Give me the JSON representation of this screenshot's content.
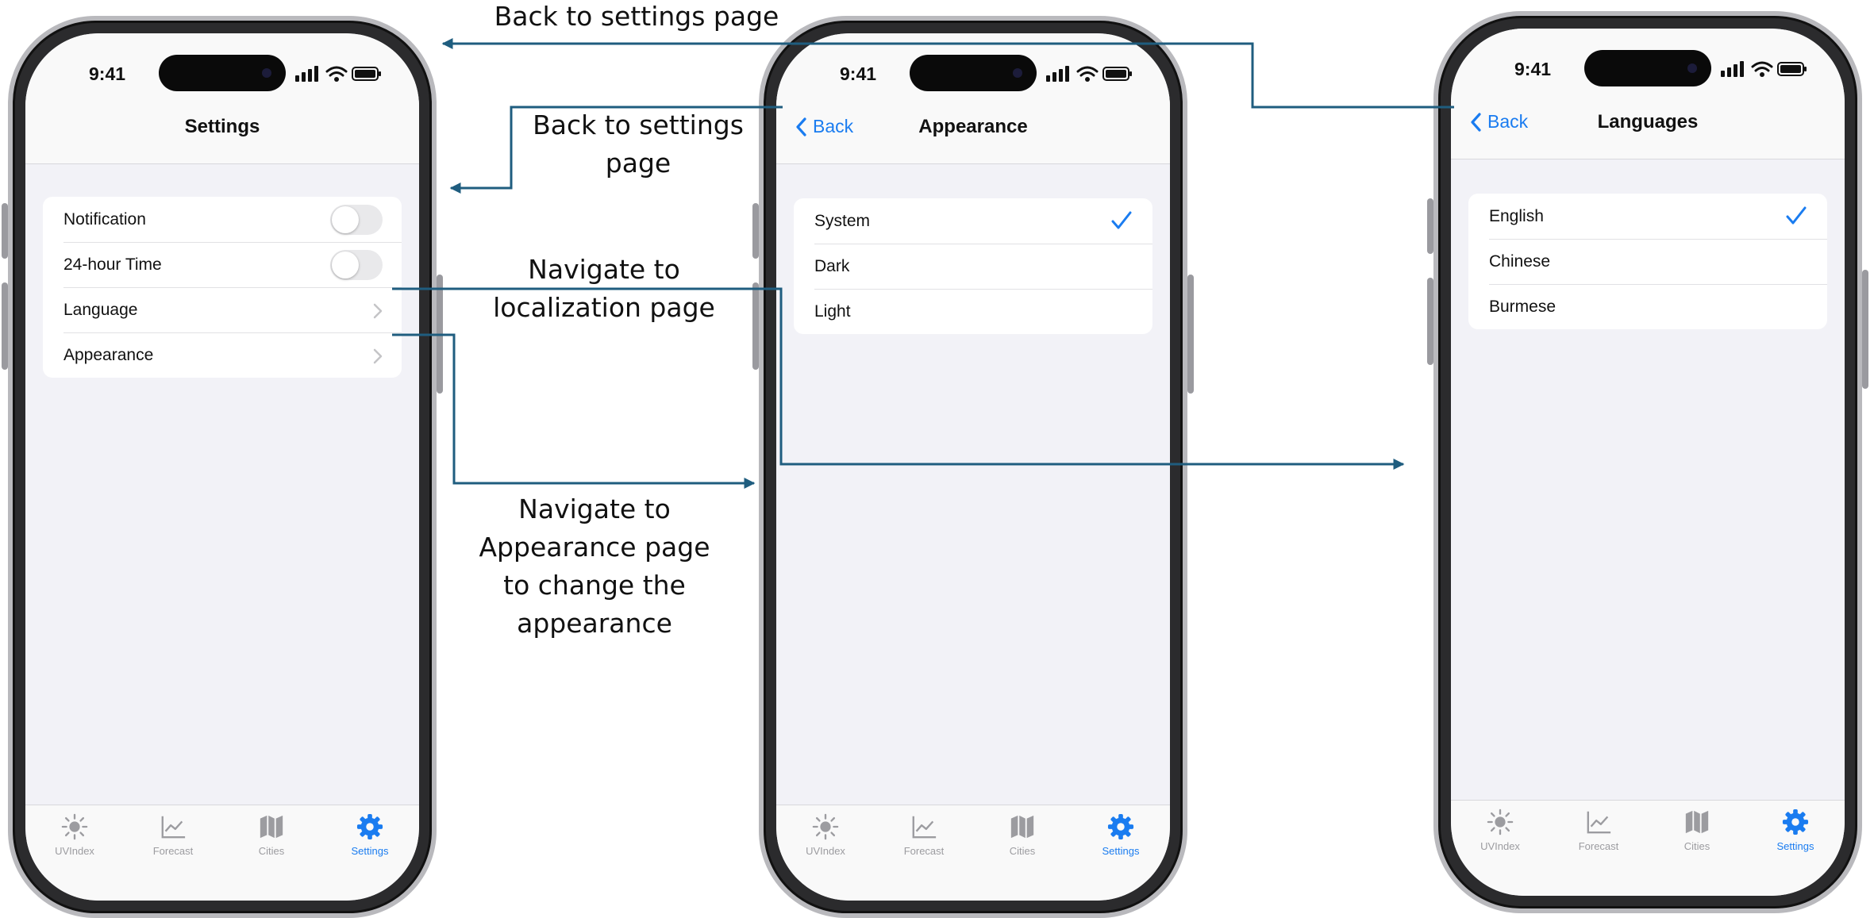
{
  "status": {
    "time": "9:41"
  },
  "screens": {
    "settings": {
      "title": "Settings",
      "rows": {
        "notification": "Notification",
        "time24": "24-hour Time",
        "language": "Language",
        "appearance": "Appearance"
      }
    },
    "appearance": {
      "back": "Back",
      "title": "Appearance",
      "options": {
        "system": "System",
        "dark": "Dark",
        "light": "Light"
      },
      "selected": "System"
    },
    "languages": {
      "back": "Back",
      "title": "Languages",
      "options": {
        "english": "English",
        "chinese": "Chinese",
        "burmese": "Burmese"
      },
      "selected": "English"
    }
  },
  "tabs": {
    "uvindex": "UVIndex",
    "forecast": "Forecast",
    "cities": "Cities",
    "settings": "Settings"
  },
  "annotations": {
    "back_top": "Back to settings page",
    "back_mid_l1": "Back to settings",
    "back_mid_l2": "page",
    "nav_loc_l1": "Navigate to",
    "nav_loc_l2": "localization page",
    "nav_app_l1": "Navigate to",
    "nav_app_l2": "Appearance page",
    "nav_app_l3": "to change the",
    "nav_app_l4": "appearance"
  },
  "colors": {
    "accent": "#1a7cf0",
    "arrow": "#1f5d7f",
    "background": "#f2f2f7",
    "toggle_off": "#e9e9eb"
  },
  "icons": [
    "sun-icon",
    "chart-icon",
    "map-icon",
    "gear-icon",
    "chevron-right-icon",
    "checkmark-icon",
    "chevron-left-icon"
  ]
}
